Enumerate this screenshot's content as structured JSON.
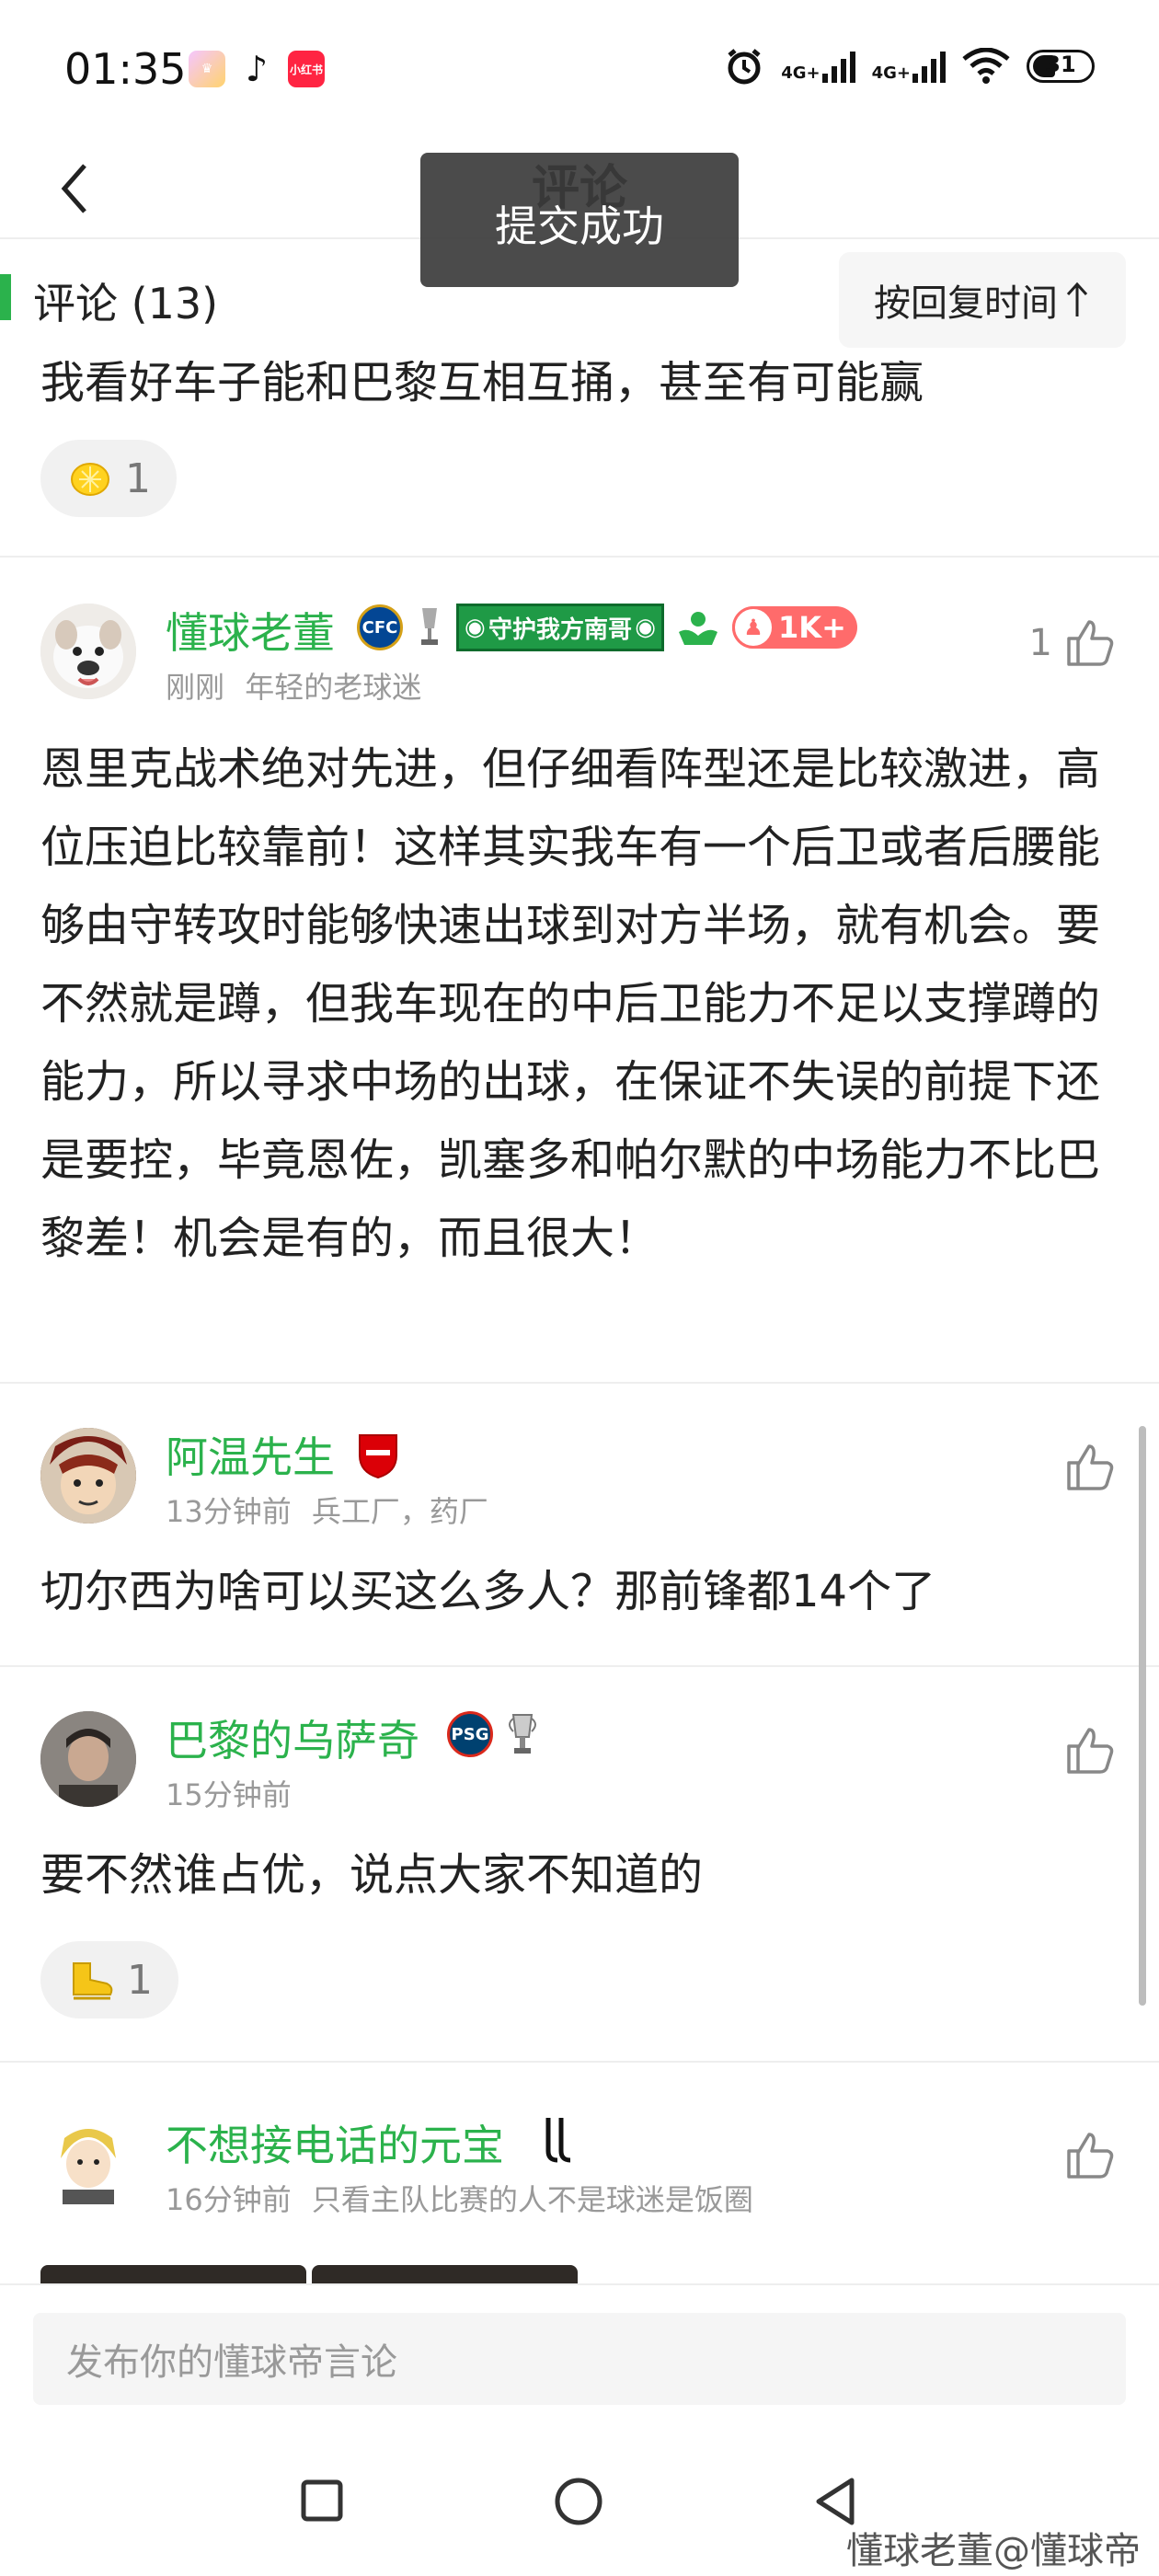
{
  "status": {
    "time": "01:35",
    "net1": "4G+",
    "net2": "4G+",
    "battery": "31"
  },
  "header": {
    "title": "评论",
    "toast": "提交成功"
  },
  "comments_header": {
    "label": "评论 (13)",
    "sort_label": "按回复时间"
  },
  "partial_comment": {
    "text": "我看好车子能和巴黎互相互捅，甚至有可能赢",
    "reaction_count": "1"
  },
  "comments": [
    {
      "username": "懂球老董",
      "time": "刚刚",
      "tag": "年轻的老球迷",
      "banner": "守护我方南哥",
      "fans_badge": "1K+",
      "likes": "1",
      "text": "恩里克战术绝对先进，但仔细看阵型还是比较激进，高位压迫比较靠前！这样其实我车有一个后卫或者后腰能够由守转攻时能够快速出球到对方半场，就有机会。要不然就是蹲，但我车现在的中后卫能力不足以支撑蹲的能力，所以寻求中场的出球，在保证不失误的前提下还是要控，毕竟恩佐，凯塞多和帕尔默的中场能力不比巴黎差！机会是有的，而且很大！"
    },
    {
      "username": "阿温先生",
      "time": "13分钟前",
      "tag": "兵工厂，药厂",
      "likes": "",
      "text": "切尔西为啥可以买这么多人？那前锋都14个了"
    },
    {
      "username": "巴黎的乌萨奇",
      "time": "15分钟前",
      "tag": "",
      "likes": "",
      "text": "要不然谁占优，说点大家不知道的",
      "reaction_count": "1"
    },
    {
      "username": "不想接电话的元宝",
      "time": "16分钟前",
      "tag": "只看主队比赛的人不是球迷是饭圈",
      "likes": ""
    }
  ],
  "input": {
    "placeholder": "发布你的懂球帝言论"
  },
  "watermark": "懂球老董@懂球帝",
  "colors": {
    "accent_green": "#2bb24c",
    "toast_bg": "#3c3c3c"
  }
}
